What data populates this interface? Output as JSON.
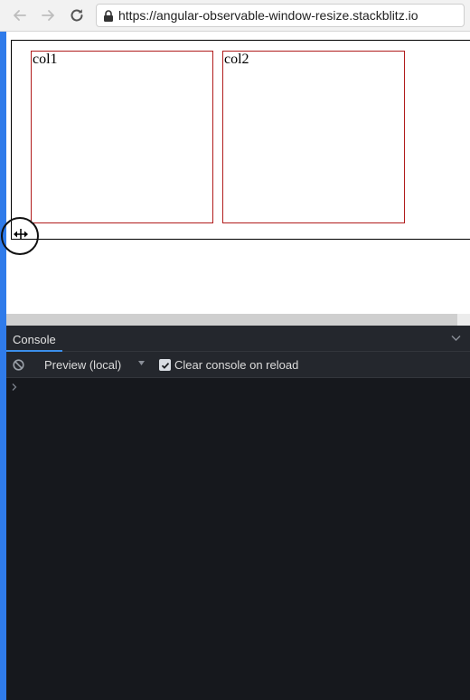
{
  "browser": {
    "url": "https://angular-observable-window-resize.stackblitz.io",
    "icons": {
      "back": "arrow-left-icon",
      "forward": "arrow-right-icon",
      "reload": "reload-icon",
      "lock": "lock-icon"
    }
  },
  "preview": {
    "columns": [
      {
        "label": "col1"
      },
      {
        "label": "col2"
      }
    ],
    "cursor": "resize-horizontal-cursor"
  },
  "console": {
    "tab_label": "Console",
    "context_label": "Preview (local)",
    "clear_on_reload_label": "Clear console on reload",
    "clear_on_reload_checked": true,
    "colors": {
      "accent": "#3b8eea",
      "background": "#16181d",
      "bar": "#24272d"
    }
  }
}
